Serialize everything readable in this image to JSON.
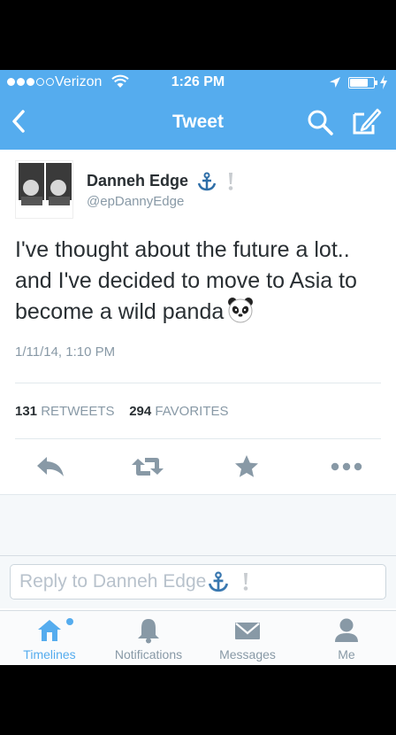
{
  "status_bar": {
    "carrier": "Verizon",
    "time": "1:26 PM",
    "signal_bars_filled": 3,
    "signal_bars_total": 5
  },
  "nav": {
    "title": "Tweet",
    "back_icon": "chevron-left-icon",
    "search_icon": "search-icon",
    "compose_icon": "compose-icon"
  },
  "tweet": {
    "display_name": "Danneh Edge",
    "handle": "@epDannyEdge",
    "text": "I've thought about the future a lot.. and I've decided to move to Asia to become a wild panda",
    "timestamp": "1/11/14, 1:10 PM",
    "retweets_count": "131",
    "retweets_label": "RETWEETS",
    "favorites_count": "294",
    "favorites_label": "FAVORITES"
  },
  "actions": [
    "reply-icon",
    "retweet-icon",
    "favorite-star-icon",
    "more-icon"
  ],
  "reply": {
    "placeholder": "Reply to Danneh Edge"
  },
  "tabs": [
    {
      "label": "Timelines",
      "icon": "home-icon",
      "active": true
    },
    {
      "label": "Notifications",
      "icon": "bell-icon",
      "active": false
    },
    {
      "label": "Messages",
      "icon": "envelope-icon",
      "active": false
    },
    {
      "label": "Me",
      "icon": "person-icon",
      "active": false
    }
  ],
  "colors": {
    "brand": "#55acee",
    "text": "#292f33",
    "muted": "#8899a6",
    "icon_gray": "#8899a6"
  }
}
